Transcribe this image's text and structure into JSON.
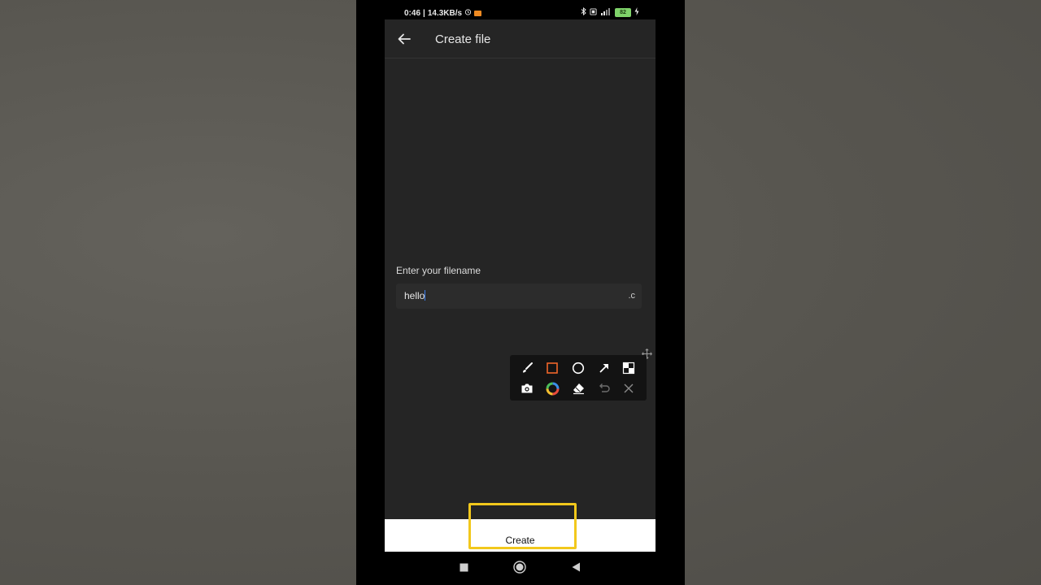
{
  "status": {
    "time": "0:46",
    "speed": "14.3KB/s",
    "battery": "82"
  },
  "appbar": {
    "title": "Create file"
  },
  "form": {
    "label": "Enter your filename",
    "value": "hello",
    "suffix": ".c"
  },
  "footer": {
    "create_label": "Create"
  },
  "toolbox": {
    "tools": [
      "brush-icon",
      "rectangle-icon",
      "circle-icon",
      "arrow-icon",
      "mosaic-icon",
      "camera-icon",
      "color-wheel-icon",
      "eraser-icon",
      "undo-icon",
      "close-icon"
    ]
  },
  "colors": {
    "background": "#252525",
    "highlight": "#f2c81c",
    "caret": "#3c7ff0",
    "rectangle_tool": "#f0662a"
  }
}
